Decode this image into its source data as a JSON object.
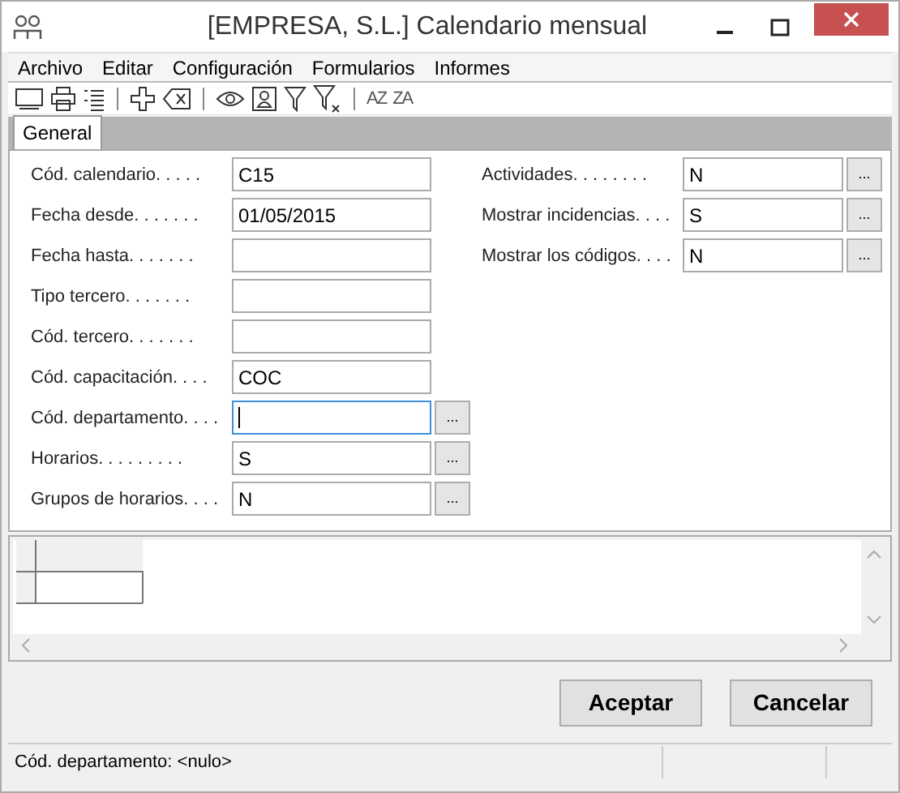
{
  "window": {
    "title": "[EMPRESA, S.L.] Calendario mensual"
  },
  "menu": [
    "Archivo",
    "Editar",
    "Configuración",
    "Formularios",
    "Informes"
  ],
  "toolbar": [
    {
      "kind": "monitor"
    },
    {
      "kind": "printer"
    },
    {
      "kind": "list"
    },
    {
      "kind": "sep"
    },
    {
      "kind": "plus"
    },
    {
      "kind": "delete"
    },
    {
      "kind": "sep"
    },
    {
      "kind": "eye"
    },
    {
      "kind": "person"
    },
    {
      "kind": "filter"
    },
    {
      "kind": "filter-x"
    },
    {
      "kind": "sep"
    },
    {
      "kind": "sort",
      "text": "AZ"
    },
    {
      "kind": "sort",
      "text": "ZA"
    }
  ],
  "tabs": [
    {
      "label": "General",
      "selected": true
    }
  ],
  "left_fields": [
    {
      "label": "Cód. calendario. . . . .",
      "value": "C15",
      "kind": "plain",
      "focused": false
    },
    {
      "label": "Fecha desde. . . . . . .",
      "value": "01/05/2015",
      "kind": "plain",
      "focused": false
    },
    {
      "label": "Fecha hasta. . . . . . .",
      "kind": "plain",
      "focused": false
    },
    {
      "label": "Tipo tercero. . . . . . .",
      "kind": "plain",
      "focused": false
    },
    {
      "label": "Cód. tercero. . . . . . .",
      "kind": "plain",
      "focused": false
    },
    {
      "label": "Cód. capacitación. . . .",
      "value": "COC",
      "kind": "plain",
      "focused": false
    },
    {
      "label": "Cód. departamento. . . .",
      "kind": "lookup",
      "focused": true,
      "button": "..."
    },
    {
      "label": "Horarios. . . . . . . . .",
      "value": "S",
      "kind": "lookup",
      "focused": false,
      "button": "..."
    },
    {
      "label": "Grupos de horarios. . . .",
      "value": "N",
      "kind": "lookup",
      "focused": false,
      "button": "..."
    }
  ],
  "right_fields": [
    {
      "label": "Actividades. . . . . . . .",
      "value": "N",
      "kind": "lookup",
      "focused": false,
      "button": "..."
    },
    {
      "label": "Mostrar incidencias. . . .",
      "value": "S",
      "kind": "lookup",
      "focused": false,
      "button": "..."
    },
    {
      "label": "Mostrar los códigos. . . .",
      "value": "N",
      "kind": "lookup",
      "focused": false,
      "button": "..."
    }
  ],
  "buttons": [
    "Aceptar",
    "Cancelar"
  ],
  "status_bar": "Cód. departamento: <nulo>"
}
